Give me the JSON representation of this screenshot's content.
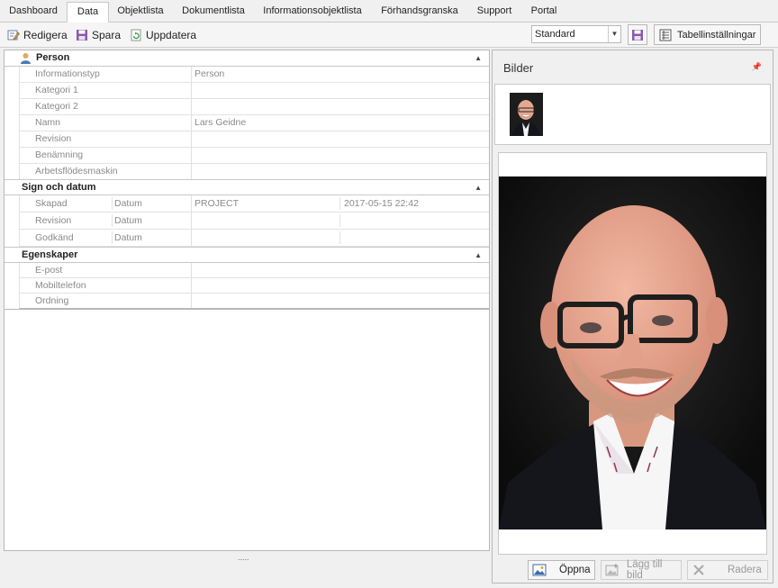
{
  "tabs": [
    "Dashboard",
    "Data",
    "Objektlista",
    "Dokumentlista",
    "Informationsobjektlista",
    "Förhandsgranska",
    "Support",
    "Portal"
  ],
  "active_tab": "Data",
  "toolbar": {
    "edit": "Redigera",
    "save": "Spara",
    "refresh": "Uppdatera",
    "view_select": "Standard",
    "table_settings": "Tabellinställningar"
  },
  "groups": {
    "person": {
      "title": "Person",
      "rows": [
        {
          "label": "Informationstyp",
          "value": "Person"
        },
        {
          "label": "Kategori 1",
          "value": ""
        },
        {
          "label": "Kategori 2",
          "value": ""
        },
        {
          "label": "Namn",
          "value": "Lars Geidne"
        },
        {
          "label": "Revision",
          "value": ""
        },
        {
          "label": "Benämning",
          "value": ""
        },
        {
          "label": "Arbetsflödesmaskin",
          "value": ""
        }
      ]
    },
    "sign": {
      "title": "Sign och datum",
      "rows": [
        {
          "label": "Skapad",
          "sub": "Datum",
          "value": "PROJECT",
          "value2": "2017-05-15 22:42"
        },
        {
          "label": "Revision",
          "sub": "Datum",
          "value": "",
          "value2": ""
        },
        {
          "label": "Godkänd",
          "sub": "Datum",
          "value": "",
          "value2": ""
        }
      ]
    },
    "props": {
      "title": "Egenskaper",
      "rows": [
        {
          "label": "E-post",
          "value": ""
        },
        {
          "label": "Mobiltelefon",
          "value": ""
        },
        {
          "label": "Ordning",
          "value": ""
        }
      ]
    }
  },
  "splitter": ".....",
  "images_panel": {
    "title": "Bilder",
    "open": "Öppna",
    "add": "Lägg till bild",
    "delete": "Radera"
  },
  "icons": [
    "edit-icon",
    "save-icon",
    "refresh-icon",
    "person-icon",
    "pin-icon",
    "image-icon",
    "add-image-icon",
    "delete-icon",
    "table-settings-icon"
  ]
}
